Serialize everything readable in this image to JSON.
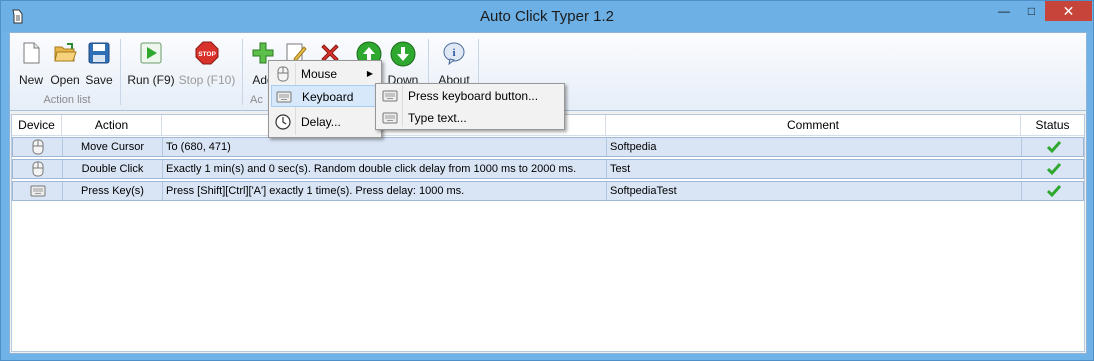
{
  "window": {
    "title": "Auto Click Typer 1.2",
    "minimize": "—",
    "maximize": "□",
    "close": "✕"
  },
  "toolbar": {
    "new_label": "New",
    "open_label": "Open",
    "save_label": "Save",
    "run_label": "Run (F9)",
    "stop_label": "Stop (F10)",
    "add_label": "Add",
    "down_label": "Down",
    "about_label": "About",
    "group_action_list": "Action list",
    "group_actions": "Ac"
  },
  "table": {
    "columns": [
      "Device",
      "Action",
      "",
      "Comment",
      "Status"
    ],
    "rows": [
      {
        "device_icon": "mouse-icon",
        "action": "Move Cursor",
        "parameters": "To (680, 471)",
        "comment": "Softpedia",
        "status": "ok"
      },
      {
        "device_icon": "mouse-icon",
        "action": "Double Click",
        "parameters": "Exactly 1 min(s) and 0 sec(s). Random double click delay from 1000 ms to 2000 ms.",
        "comment": "Test",
        "status": "ok"
      },
      {
        "device_icon": "keyboard-icon",
        "action": "Press Key(s)",
        "parameters": "Press [Shift][Ctrl]['A'] exactly 1 time(s). Press delay: 1000 ms.",
        "comment": "SoftpediaTest",
        "status": "ok"
      }
    ]
  },
  "add_menu": {
    "items": [
      {
        "label": "Mouse",
        "icon": "mouse-icon",
        "submenu": true
      },
      {
        "label": "Keyboard",
        "icon": "keyboard-icon",
        "submenu": true,
        "highlighted": true
      },
      {
        "label": "Delay...",
        "icon": "clock-icon",
        "submenu": false
      }
    ]
  },
  "keyboard_submenu": {
    "items": [
      {
        "label": "Press keyboard button...",
        "icon": "keyboard-icon"
      },
      {
        "label": "Type text...",
        "icon": "keyboard-icon"
      }
    ]
  },
  "colors": {
    "title_bar": "#6cb0e6",
    "close_button": "#c7443b",
    "row_background": "#d9e5f5",
    "check_green": "#2ea82e"
  }
}
